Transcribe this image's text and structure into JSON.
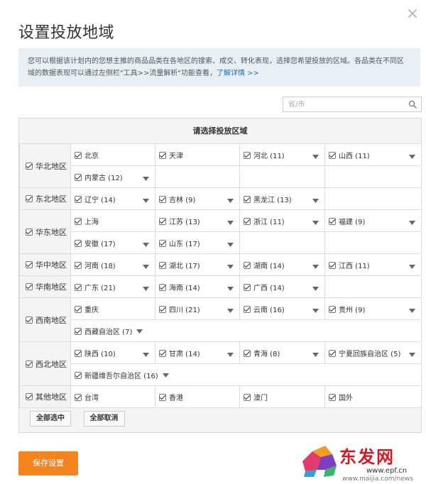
{
  "dialog": {
    "title": "设置投放地域",
    "notice": "您可以根据该计划内的您想主推的商品品类在各地区的搜索、成交、转化表现，选择您希望投放的区域。各品类在不同区域的数据表现可以通过左侧栏\"工具>>流量解析\"功能查看，",
    "notice_link": "了解详情 >>"
  },
  "search": {
    "placeholder": "省/市",
    "value": ""
  },
  "panel": {
    "title": "请选择投放区域"
  },
  "regions": [
    {
      "name": "华北地区",
      "rows": [
        [
          {
            "name": "北京",
            "dd": false
          },
          {
            "name": "天津",
            "dd": false
          },
          {
            "name": "河北 (11)",
            "dd": true
          },
          {
            "name": "山西 (11)",
            "dd": true
          }
        ],
        [
          {
            "name": "内蒙古 (12)",
            "dd": true
          }
        ]
      ]
    },
    {
      "name": "东北地区",
      "rows": [
        [
          {
            "name": "辽宁 (14)",
            "dd": true
          },
          {
            "name": "吉林 (9)",
            "dd": true
          },
          {
            "name": "黑龙江 (13)",
            "dd": true
          }
        ]
      ]
    },
    {
      "name": "华东地区",
      "rows": [
        [
          {
            "name": "上海",
            "dd": false
          },
          {
            "name": "江苏 (13)",
            "dd": true
          },
          {
            "name": "浙江 (11)",
            "dd": true
          },
          {
            "name": "福建 (9)",
            "dd": true
          }
        ],
        [
          {
            "name": "安徽 (17)",
            "dd": true
          },
          {
            "name": "山东 (17)",
            "dd": true
          }
        ]
      ]
    },
    {
      "name": "华中地区",
      "rows": [
        [
          {
            "name": "河南 (18)",
            "dd": true
          },
          {
            "name": "湖北 (17)",
            "dd": true
          },
          {
            "name": "湖南 (14)",
            "dd": true
          },
          {
            "name": "江西 (11)",
            "dd": true
          }
        ]
      ]
    },
    {
      "name": "华南地区",
      "rows": [
        [
          {
            "name": "广东 (21)",
            "dd": true
          },
          {
            "name": "海南 (14)",
            "dd": true
          },
          {
            "name": "广西 (14)",
            "dd": true
          }
        ]
      ]
    },
    {
      "name": "西南地区",
      "rows": [
        [
          {
            "name": "重庆",
            "dd": false
          },
          {
            "name": "四川 (21)",
            "dd": true
          },
          {
            "name": "云南 (16)",
            "dd": true
          },
          {
            "name": "贵州 (9)",
            "dd": true
          }
        ],
        [
          {
            "name": "西藏自治区 (7)",
            "dd": true,
            "wide": true
          }
        ]
      ]
    },
    {
      "name": "西北地区",
      "rows": [
        [
          {
            "name": "陕西 (10)",
            "dd": true
          },
          {
            "name": "甘肃 (14)",
            "dd": true
          },
          {
            "name": "青海 (8)",
            "dd": true
          },
          {
            "name": "宁夏回族自治区 (5)",
            "dd": true
          }
        ],
        [
          {
            "name": "新疆维吾尔自治区 (16)",
            "dd": true,
            "wide": true
          }
        ]
      ]
    },
    {
      "name": "其他地区",
      "rows": [
        [
          {
            "name": "台湾",
            "dd": false
          },
          {
            "name": "香港",
            "dd": false
          },
          {
            "name": "澳门",
            "dd": false
          },
          {
            "name": "国外",
            "dd": false
          }
        ]
      ]
    }
  ],
  "buttons": {
    "select_all": "全部选中",
    "deselect_all": "全部取消",
    "save": "保存设置"
  },
  "watermark": {
    "logo_text": "东发网",
    "url": "www.epf.cn",
    "url2": "www.maijia.com/news"
  },
  "colors": {
    "accent": "#f5841f",
    "link": "#1f6fb2",
    "notice_bg": "#e8f0f6",
    "watermark": "#d11b24"
  },
  "icons": {
    "close": "close-icon",
    "search": "search-icon",
    "dropdown": "chevron-down-icon",
    "checkbox": "checkbox-checked-icon"
  }
}
